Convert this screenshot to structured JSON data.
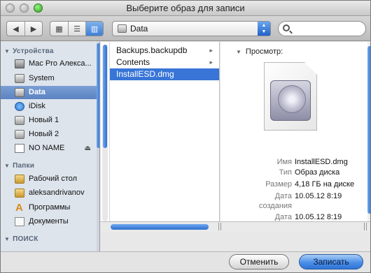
{
  "window": {
    "title": "Выберите образ для записи"
  },
  "toolbar": {
    "back_icon": "triangle-left",
    "forward_icon": "triangle-right",
    "view_icons": "icon-view",
    "view_list": "list-view",
    "view_columns": "column-view",
    "path_value": "Data",
    "search_placeholder": ""
  },
  "sidebar": {
    "devices_header": "Устройства",
    "devices": [
      {
        "label": "Mac Pro Алекса...",
        "icon": "computer-icon",
        "selected": false
      },
      {
        "label": "System",
        "icon": "drive-icon",
        "selected": false
      },
      {
        "label": "Data",
        "icon": "drive-icon",
        "selected": true
      },
      {
        "label": "iDisk",
        "icon": "idisk-icon",
        "selected": false
      },
      {
        "label": "Новый 1",
        "icon": "drive-icon",
        "selected": false
      },
      {
        "label": "Новый 2",
        "icon": "drive-icon",
        "selected": false
      },
      {
        "label": "NO NAME",
        "icon": "removable-drive-icon",
        "selected": false
      }
    ],
    "places_header": "Папки",
    "places": [
      {
        "label": "Рабочий стол",
        "icon": "desktop-folder-icon"
      },
      {
        "label": "aleksandrivanov",
        "icon": "home-icon"
      },
      {
        "label": "Программы",
        "icon": "applications-icon"
      },
      {
        "label": "Документы",
        "icon": "documents-icon"
      }
    ],
    "search_header": "ПОИСК"
  },
  "browser": {
    "column1": [
      {
        "label": "Backups.backupdb",
        "has_children": true,
        "selected": false
      },
      {
        "label": "Contents",
        "has_children": true,
        "selected": false
      },
      {
        "label": "InstallESD.dmg",
        "has_children": false,
        "selected": true
      }
    ],
    "chevron": "▸"
  },
  "preview": {
    "header": "Просмотр:",
    "meta": [
      {
        "key": "Имя",
        "value": "InstallESD.dmg"
      },
      {
        "key": "Тип",
        "value": "Образ диска"
      },
      {
        "key": "Размер",
        "value": "4,18 ГБ на диске"
      },
      {
        "key": "Дата создания",
        "value": "10.05.12 8:19"
      },
      {
        "key": "Дата изменения",
        "value": "10.05.12 8:19"
      }
    ]
  },
  "buttons": {
    "cancel": "Отменить",
    "save": "Записать"
  }
}
